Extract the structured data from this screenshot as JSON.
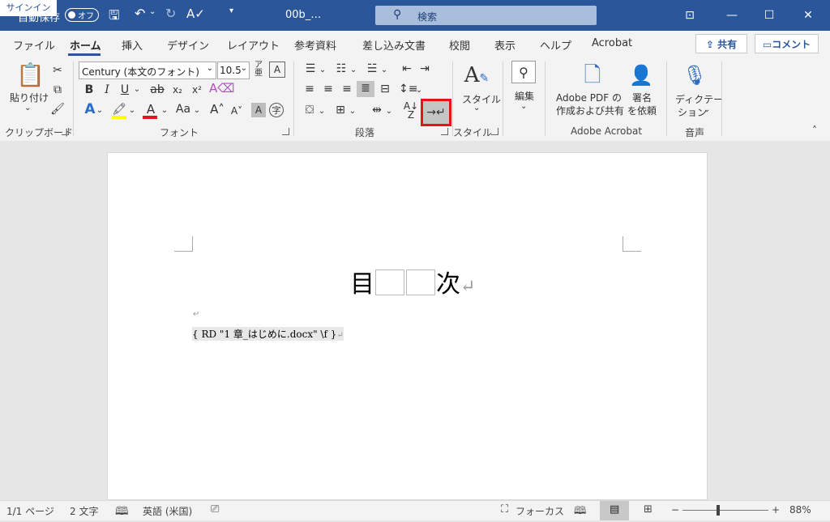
{
  "titlebar": {
    "autosave_label": "自動保存",
    "autosave_state": "オフ",
    "filename": "00b_…",
    "search_placeholder": "検索",
    "signin_label": "サインイン"
  },
  "tabs": [
    "ファイル",
    "ホーム",
    "挿入",
    "デザイン",
    "レイアウト",
    "参考資料",
    "差し込み文書",
    "校閲",
    "表示",
    "ヘルプ",
    "Acrobat"
  ],
  "active_tab": "ホーム",
  "share_label": "共有",
  "comment_label": "コメント",
  "ribbon": {
    "clipboard": {
      "paste_label": "貼り付け",
      "group_label": "クリップボード"
    },
    "font": {
      "font_name": "Century (本文のフォント)",
      "font_size": "10.5",
      "group_label": "フォント"
    },
    "paragraph": {
      "group_label": "段落"
    },
    "styles": {
      "style_label": "スタイル",
      "group_label": "スタイル"
    },
    "editing": {
      "label": "編集"
    },
    "acrobat": {
      "create_pdf_line1": "Adobe PDF の",
      "create_pdf_line2": "作成および共有",
      "sign_line1": "署名",
      "sign_line2": "を依頼",
      "group_label": "Adobe Acrobat"
    },
    "voice": {
      "dictate_line1": "ディクテー",
      "dictate_line2": "ション",
      "group_label": "音声"
    }
  },
  "document": {
    "title_left": "目",
    "title_right": "次",
    "field_code": "{ RD \"1 章_はじめに.docx\" \\f }"
  },
  "status": {
    "page": "1/1 ページ",
    "words": "2 文字",
    "language": "英語 (米国)",
    "focus": "フォーカス",
    "zoom": "88%"
  },
  "colors": {
    "brand": "#2b579a",
    "highlight": "#e0141e"
  }
}
